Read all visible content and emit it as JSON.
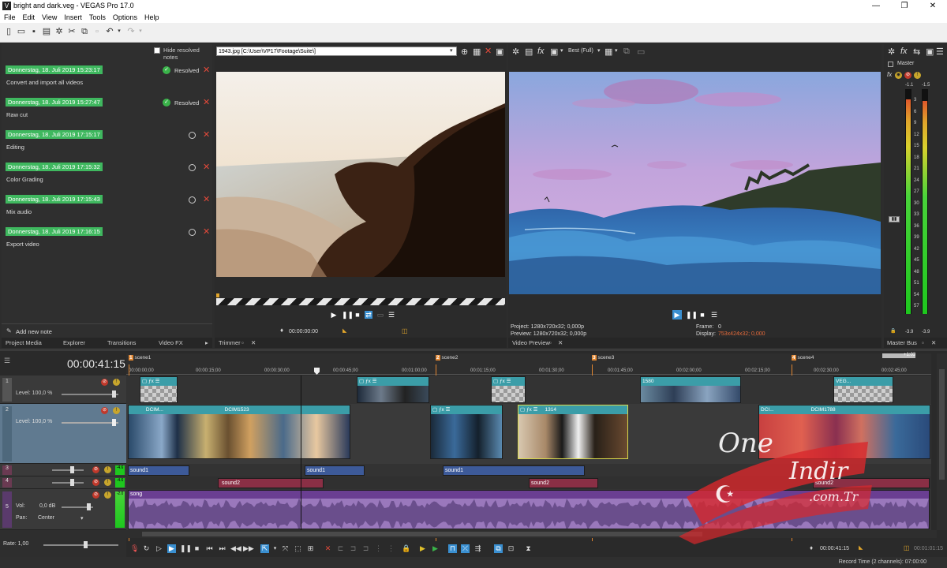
{
  "window": {
    "title": "bright and dark.veg - VEGAS Pro 17.0",
    "app_icon": "V",
    "min": "—",
    "max": "❐",
    "close": "✕"
  },
  "menu": [
    "File",
    "Edit",
    "View",
    "Insert",
    "Tools",
    "Options",
    "Help"
  ],
  "notes": {
    "hide_label": "Hide resolved notes",
    "items": [
      {
        "date": "Donnerstag, 18. Juli 2019 15:23:17",
        "text": "Convert and import all videos",
        "status": "Resolved",
        "resolved": true
      },
      {
        "date": "Donnerstag, 18. Juli 2019 15:27:47",
        "text": "Raw cut",
        "status": "Resolved",
        "resolved": true
      },
      {
        "date": "Donnerstag, 18. Juli 2019 17:15:17",
        "text": "Editing",
        "status": "",
        "resolved": false
      },
      {
        "date": "Donnerstag, 18. Juli 2019 17:15:32",
        "text": "Color Grading",
        "status": "",
        "resolved": false
      },
      {
        "date": "Donnerstag, 18. Juli 2019 17:15:43",
        "text": "Mix audio",
        "status": "",
        "resolved": false
      },
      {
        "date": "Donnerstag, 18. Juli 2019 17:16:15",
        "text": "Export video",
        "status": "",
        "resolved": false
      }
    ],
    "add_label": "Add new note"
  },
  "left_tabs": [
    "Project Media",
    "Explorer",
    "Transitions",
    "Video FX"
  ],
  "trimmer": {
    "path": "1943.jpg    [C:\\User\\VP17\\Footage\\Suite\\]",
    "time": "00:00:00:00",
    "tab": "Trimmer"
  },
  "preview": {
    "quality": "Best (Full)",
    "project": "Project:   1280x720x32; 0,000p",
    "previewinfo": "Preview:   1280x720x32; 0,000p",
    "frame_label": "Frame:",
    "frame_value": "0",
    "display_label": "Display:",
    "display_value": "753x424x32; 0,000",
    "tab": "Video Preview"
  },
  "master": {
    "label": "Master",
    "tab": "Master Bus",
    "peak_l": "-1.1",
    "peak_r": "-1.5",
    "bottom_l": "-3.9",
    "bottom_r": "-3.9",
    "scale": [
      "3",
      "6",
      "9",
      "12",
      "15",
      "18",
      "21",
      "24",
      "27",
      "30",
      "33",
      "36",
      "39",
      "42",
      "45",
      "48",
      "51",
      "54",
      "57"
    ]
  },
  "timeline": {
    "timecode": "00:00:41:15",
    "ruler": [
      "00:00:00;00",
      "00:00:15;00",
      "00:00:30;00",
      "00:00:45;00",
      "00:01:00;00",
      "00:01:15;00",
      "00:01:30;00",
      "00:01:45;00",
      "00:02:00;00",
      "00:02:15;00",
      "00:02:30;00",
      "00:02:45;00"
    ],
    "markers": [
      "scene1",
      "scene2",
      "scene3",
      "scene4"
    ],
    "region_tag": "+1:03",
    "track1": {
      "num": "1",
      "level": "Level: 100,0 %"
    },
    "track2": {
      "num": "2",
      "level": "Level: 100,0 %"
    },
    "track3": {
      "num": "3"
    },
    "track4": {
      "num": "4"
    },
    "track5": {
      "num": "5",
      "vol": "Vol:",
      "vol_value": "0,0 dB",
      "pan": "Pan:",
      "pan_value": "Center"
    },
    "db_values": [
      "-4.6",
      "-4.6",
      "-2.0"
    ],
    "clips": {
      "c1580": "1580",
      "cveg": "VEG...",
      "cdcim": "DCIM...",
      "cdcim1523": "DCIM1523",
      "c1314": "1314",
      "cdci": "DCI...",
      "cdcim1788": "DCIM1788"
    },
    "audio": {
      "sound1": "sound1",
      "sound2": "sound2",
      "song": "song"
    },
    "rate": "Rate: 1,00",
    "cursor_time": "00:00:41:15",
    "end_time": "00:01:01:15",
    "record_time": "Record Time (2 channels): 07:00:00"
  },
  "watermark": {
    "line1": "One",
    "line2": "Indir",
    ".com.tr": ".com.Tr"
  }
}
